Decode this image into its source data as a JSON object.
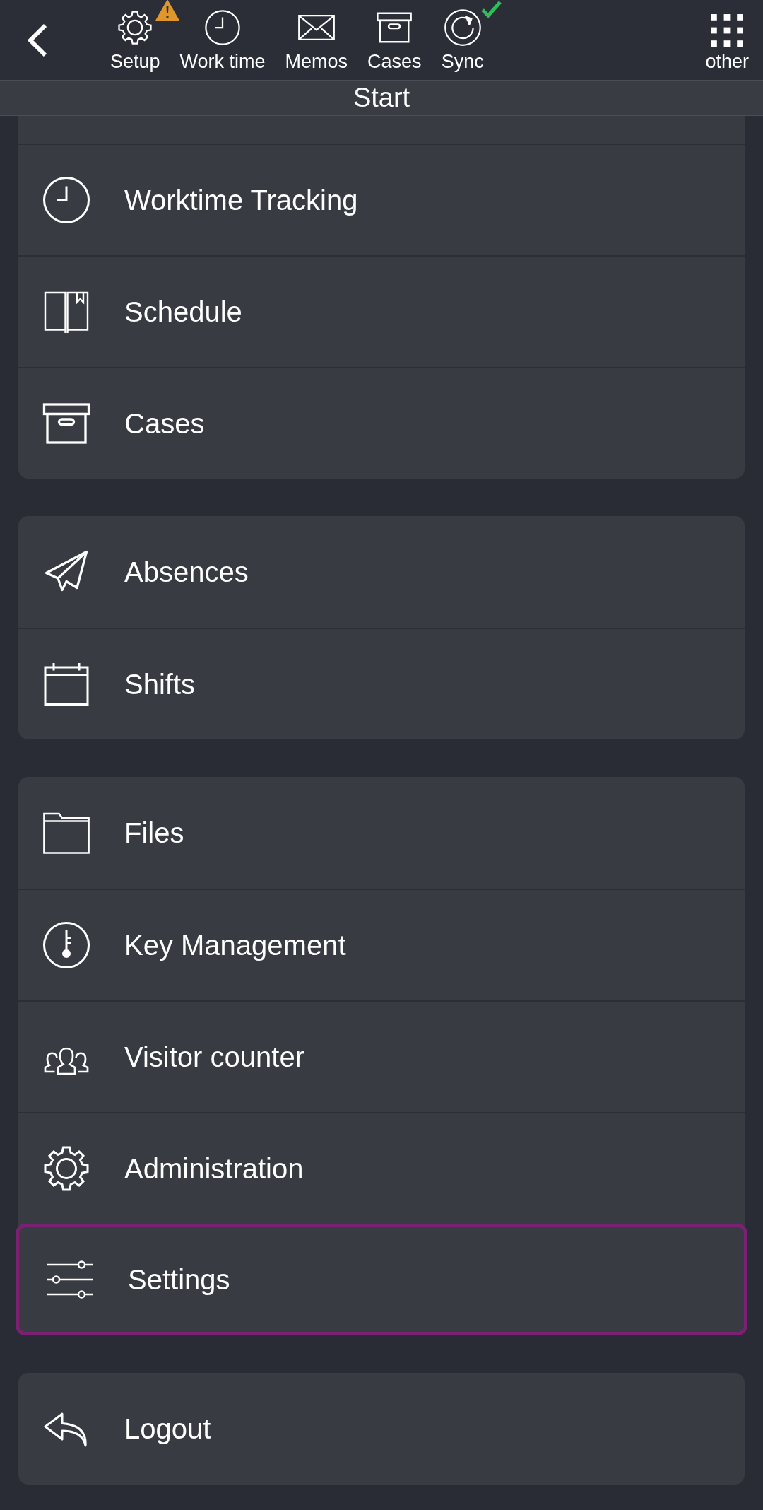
{
  "toolbar": {
    "items": [
      {
        "label": "Setup",
        "warning": true,
        "synced": false
      },
      {
        "label": "Work time",
        "warning": false,
        "synced": false
      },
      {
        "label": "Memos",
        "warning": false,
        "synced": false
      },
      {
        "label": "Cases",
        "warning": false,
        "synced": false
      },
      {
        "label": "Sync",
        "warning": false,
        "synced": true
      }
    ],
    "more": {
      "label": "other"
    }
  },
  "title": "Start",
  "groups": [
    {
      "items": [
        {
          "label": "Worktime Tracking",
          "selected": false
        },
        {
          "label": "Schedule",
          "selected": false
        },
        {
          "label": "Cases",
          "selected": false
        }
      ]
    },
    {
      "items": [
        {
          "label": "Absences",
          "selected": false
        },
        {
          "label": "Shifts",
          "selected": false
        }
      ]
    },
    {
      "items": [
        {
          "label": "Files",
          "selected": false
        },
        {
          "label": "Key Management",
          "selected": false
        },
        {
          "label": "Visitor counter",
          "selected": false
        },
        {
          "label": "Administration",
          "selected": false
        },
        {
          "label": "Settings",
          "selected": true
        }
      ]
    },
    {
      "items": [
        {
          "label": "Logout",
          "selected": false
        }
      ]
    }
  ]
}
